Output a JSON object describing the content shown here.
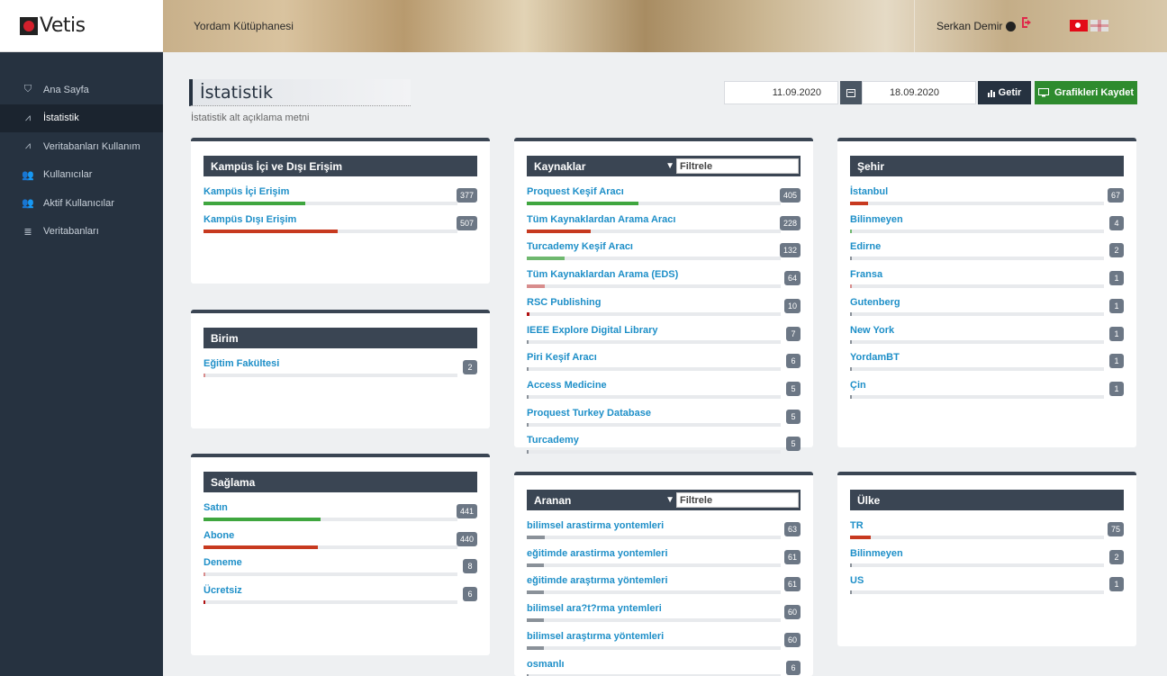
{
  "app": {
    "logo_text": "Vetis",
    "library_name": "Yordam Kütüphanesi",
    "user_name": "Serkan Demir"
  },
  "sidebar": {
    "items": [
      {
        "label": "Ana Sayfa",
        "icon": "shield-icon"
      },
      {
        "label": "İstatistik",
        "icon": "chart-icon",
        "active": true
      },
      {
        "label": "Veritabanları Kullanım",
        "icon": "chart-icon"
      },
      {
        "label": "Kullanıcılar",
        "icon": "users-icon"
      },
      {
        "label": "Aktif Kullanıcılar",
        "icon": "users-icon"
      },
      {
        "label": "Veritabanları",
        "icon": "database-icon"
      }
    ]
  },
  "page": {
    "title": "İstatistik",
    "subtitle": "İstatistik alt açıklama metni"
  },
  "toolbar": {
    "start_date": "11.09.2020",
    "end_date": "18.09.2020",
    "getir_label": "Getir",
    "save_label": "Grafikleri Kaydet"
  },
  "colors": {
    "green": "#3fa63f",
    "red": "#c7391f",
    "light_green": "#6fb86f",
    "salmon": "#d88d8d",
    "dark_red": "#b01010",
    "gray": "#8a9199"
  },
  "panels": {
    "kampus": {
      "title": "Kampüs İçi ve Dışı Erişim",
      "rows": [
        {
          "label": "Kampüs İçi Erişim",
          "value": "377",
          "fraction": 0.4,
          "color": "#3fa63f"
        },
        {
          "label": "Kampüs Dışı Erişim",
          "value": "507",
          "fraction": 0.53,
          "color": "#c7391f"
        }
      ]
    },
    "birim": {
      "title": "Birim",
      "rows": [
        {
          "label": "Eğitim Fakültesi",
          "value": "2",
          "fraction": 0.005,
          "color": "#d88d8d"
        }
      ]
    },
    "saglama": {
      "title": "Sağlama",
      "rows": [
        {
          "label": "Satın",
          "value": "441",
          "fraction": 0.46,
          "color": "#3fa63f"
        },
        {
          "label": "Abone",
          "value": "440",
          "fraction": 0.45,
          "color": "#c7391f"
        },
        {
          "label": "Deneme",
          "value": "8",
          "fraction": 0.008,
          "color": "#d88d8d"
        },
        {
          "label": "Ücretsiz",
          "value": "6",
          "fraction": 0.006,
          "color": "#b01010"
        }
      ]
    },
    "kaynaklar": {
      "title": "Kaynaklar",
      "filter_placeholder": "Filtrele",
      "rows": [
        {
          "label": "Proquest Keşif Aracı",
          "value": "405",
          "fraction": 0.44,
          "color": "#3fa63f"
        },
        {
          "label": "Tüm Kaynaklardan Arama Aracı",
          "value": "228",
          "fraction": 0.25,
          "color": "#c7391f"
        },
        {
          "label": "Turcademy Keşif Aracı",
          "value": "132",
          "fraction": 0.15,
          "color": "#6fb86f"
        },
        {
          "label": "Tüm Kaynaklardan Arama (EDS)",
          "value": "64",
          "fraction": 0.07,
          "color": "#d88d8d"
        },
        {
          "label": "RSC Publishing",
          "value": "10",
          "fraction": 0.01,
          "color": "#b01010"
        },
        {
          "label": "IEEE Explore Digital Library",
          "value": "7",
          "fraction": 0.006,
          "color": "#8a9199"
        },
        {
          "label": "Piri Keşif Aracı",
          "value": "6",
          "fraction": 0.005,
          "color": "#8a9199"
        },
        {
          "label": "Access Medicine",
          "value": "5",
          "fraction": 0.005,
          "color": "#8a9199"
        },
        {
          "label": "Proquest Turkey Database",
          "value": "5",
          "fraction": 0.005,
          "color": "#8a9199"
        },
        {
          "label": "Turcademy",
          "value": "5",
          "fraction": 0.005,
          "color": "#8a9199"
        }
      ]
    },
    "aranan": {
      "title": "Aranan",
      "filter_placeholder": "Filtrele",
      "rows": [
        {
          "label": "bilimsel arastirma yontemleri",
          "value": "63",
          "fraction": 0.07,
          "color": "#8a9199"
        },
        {
          "label": "eğitimde arastirma yontemleri",
          "value": "61",
          "fraction": 0.068,
          "color": "#8a9199"
        },
        {
          "label": "eğitimde araştırma yöntemleri",
          "value": "61",
          "fraction": 0.068,
          "color": "#8a9199"
        },
        {
          "label": "bilimsel ara?t?rma yntemleri",
          "value": "60",
          "fraction": 0.067,
          "color": "#8a9199"
        },
        {
          "label": "bilimsel araştırma yöntemleri",
          "value": "60",
          "fraction": 0.067,
          "color": "#8a9199"
        },
        {
          "label": "osmanlı",
          "value": "6",
          "fraction": 0.005,
          "color": "#8a9199"
        }
      ]
    },
    "sehir": {
      "title": "Şehir",
      "rows": [
        {
          "label": "İstanbul",
          "value": "67",
          "fraction": 0.07,
          "color": "#c7391f"
        },
        {
          "label": "Bilinmeyen",
          "value": "4",
          "fraction": 0.004,
          "color": "#6fb86f"
        },
        {
          "label": "Edirne",
          "value": "2",
          "fraction": 0.003,
          "color": "#8a9199"
        },
        {
          "label": "Fransa",
          "value": "1",
          "fraction": 0.003,
          "color": "#d88d8d"
        },
        {
          "label": "Gutenberg",
          "value": "1",
          "fraction": 0.003,
          "color": "#8a9199"
        },
        {
          "label": "New York",
          "value": "1",
          "fraction": 0.003,
          "color": "#8a9199"
        },
        {
          "label": "YordamBT",
          "value": "1",
          "fraction": 0.003,
          "color": "#8a9199"
        },
        {
          "label": "Çin",
          "value": "1",
          "fraction": 0.003,
          "color": "#8a9199"
        }
      ]
    },
    "ulke": {
      "title": "Ülke",
      "rows": [
        {
          "label": "TR",
          "value": "75",
          "fraction": 0.08,
          "color": "#c7391f"
        },
        {
          "label": "Bilinmeyen",
          "value": "2",
          "fraction": 0.003,
          "color": "#8a9199"
        },
        {
          "label": "US",
          "value": "1",
          "fraction": 0.003,
          "color": "#8a9199"
        }
      ]
    }
  }
}
